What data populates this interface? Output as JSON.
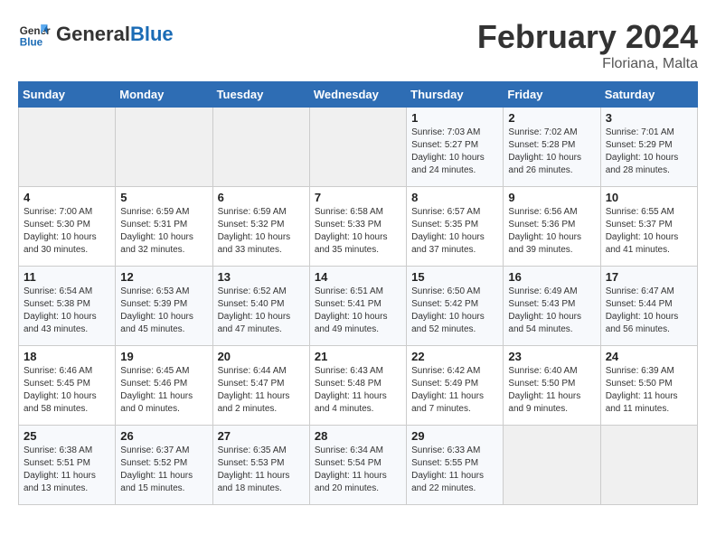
{
  "header": {
    "logo_general": "General",
    "logo_blue": "Blue",
    "title": "February 2024",
    "subtitle": "Floriana, Malta"
  },
  "weekdays": [
    "Sunday",
    "Monday",
    "Tuesday",
    "Wednesday",
    "Thursday",
    "Friday",
    "Saturday"
  ],
  "weeks": [
    [
      {
        "day": "",
        "info": ""
      },
      {
        "day": "",
        "info": ""
      },
      {
        "day": "",
        "info": ""
      },
      {
        "day": "",
        "info": ""
      },
      {
        "day": "1",
        "info": "Sunrise: 7:03 AM\nSunset: 5:27 PM\nDaylight: 10 hours\nand 24 minutes."
      },
      {
        "day": "2",
        "info": "Sunrise: 7:02 AM\nSunset: 5:28 PM\nDaylight: 10 hours\nand 26 minutes."
      },
      {
        "day": "3",
        "info": "Sunrise: 7:01 AM\nSunset: 5:29 PM\nDaylight: 10 hours\nand 28 minutes."
      }
    ],
    [
      {
        "day": "4",
        "info": "Sunrise: 7:00 AM\nSunset: 5:30 PM\nDaylight: 10 hours\nand 30 minutes."
      },
      {
        "day": "5",
        "info": "Sunrise: 6:59 AM\nSunset: 5:31 PM\nDaylight: 10 hours\nand 32 minutes."
      },
      {
        "day": "6",
        "info": "Sunrise: 6:59 AM\nSunset: 5:32 PM\nDaylight: 10 hours\nand 33 minutes."
      },
      {
        "day": "7",
        "info": "Sunrise: 6:58 AM\nSunset: 5:33 PM\nDaylight: 10 hours\nand 35 minutes."
      },
      {
        "day": "8",
        "info": "Sunrise: 6:57 AM\nSunset: 5:35 PM\nDaylight: 10 hours\nand 37 minutes."
      },
      {
        "day": "9",
        "info": "Sunrise: 6:56 AM\nSunset: 5:36 PM\nDaylight: 10 hours\nand 39 minutes."
      },
      {
        "day": "10",
        "info": "Sunrise: 6:55 AM\nSunset: 5:37 PM\nDaylight: 10 hours\nand 41 minutes."
      }
    ],
    [
      {
        "day": "11",
        "info": "Sunrise: 6:54 AM\nSunset: 5:38 PM\nDaylight: 10 hours\nand 43 minutes."
      },
      {
        "day": "12",
        "info": "Sunrise: 6:53 AM\nSunset: 5:39 PM\nDaylight: 10 hours\nand 45 minutes."
      },
      {
        "day": "13",
        "info": "Sunrise: 6:52 AM\nSunset: 5:40 PM\nDaylight: 10 hours\nand 47 minutes."
      },
      {
        "day": "14",
        "info": "Sunrise: 6:51 AM\nSunset: 5:41 PM\nDaylight: 10 hours\nand 49 minutes."
      },
      {
        "day": "15",
        "info": "Sunrise: 6:50 AM\nSunset: 5:42 PM\nDaylight: 10 hours\nand 52 minutes."
      },
      {
        "day": "16",
        "info": "Sunrise: 6:49 AM\nSunset: 5:43 PM\nDaylight: 10 hours\nand 54 minutes."
      },
      {
        "day": "17",
        "info": "Sunrise: 6:47 AM\nSunset: 5:44 PM\nDaylight: 10 hours\nand 56 minutes."
      }
    ],
    [
      {
        "day": "18",
        "info": "Sunrise: 6:46 AM\nSunset: 5:45 PM\nDaylight: 10 hours\nand 58 minutes."
      },
      {
        "day": "19",
        "info": "Sunrise: 6:45 AM\nSunset: 5:46 PM\nDaylight: 11 hours\nand 0 minutes."
      },
      {
        "day": "20",
        "info": "Sunrise: 6:44 AM\nSunset: 5:47 PM\nDaylight: 11 hours\nand 2 minutes."
      },
      {
        "day": "21",
        "info": "Sunrise: 6:43 AM\nSunset: 5:48 PM\nDaylight: 11 hours\nand 4 minutes."
      },
      {
        "day": "22",
        "info": "Sunrise: 6:42 AM\nSunset: 5:49 PM\nDaylight: 11 hours\nand 7 minutes."
      },
      {
        "day": "23",
        "info": "Sunrise: 6:40 AM\nSunset: 5:50 PM\nDaylight: 11 hours\nand 9 minutes."
      },
      {
        "day": "24",
        "info": "Sunrise: 6:39 AM\nSunset: 5:50 PM\nDaylight: 11 hours\nand 11 minutes."
      }
    ],
    [
      {
        "day": "25",
        "info": "Sunrise: 6:38 AM\nSunset: 5:51 PM\nDaylight: 11 hours\nand 13 minutes."
      },
      {
        "day": "26",
        "info": "Sunrise: 6:37 AM\nSunset: 5:52 PM\nDaylight: 11 hours\nand 15 minutes."
      },
      {
        "day": "27",
        "info": "Sunrise: 6:35 AM\nSunset: 5:53 PM\nDaylight: 11 hours\nand 18 minutes."
      },
      {
        "day": "28",
        "info": "Sunrise: 6:34 AM\nSunset: 5:54 PM\nDaylight: 11 hours\nand 20 minutes."
      },
      {
        "day": "29",
        "info": "Sunrise: 6:33 AM\nSunset: 5:55 PM\nDaylight: 11 hours\nand 22 minutes."
      },
      {
        "day": "",
        "info": ""
      },
      {
        "day": "",
        "info": ""
      }
    ]
  ]
}
